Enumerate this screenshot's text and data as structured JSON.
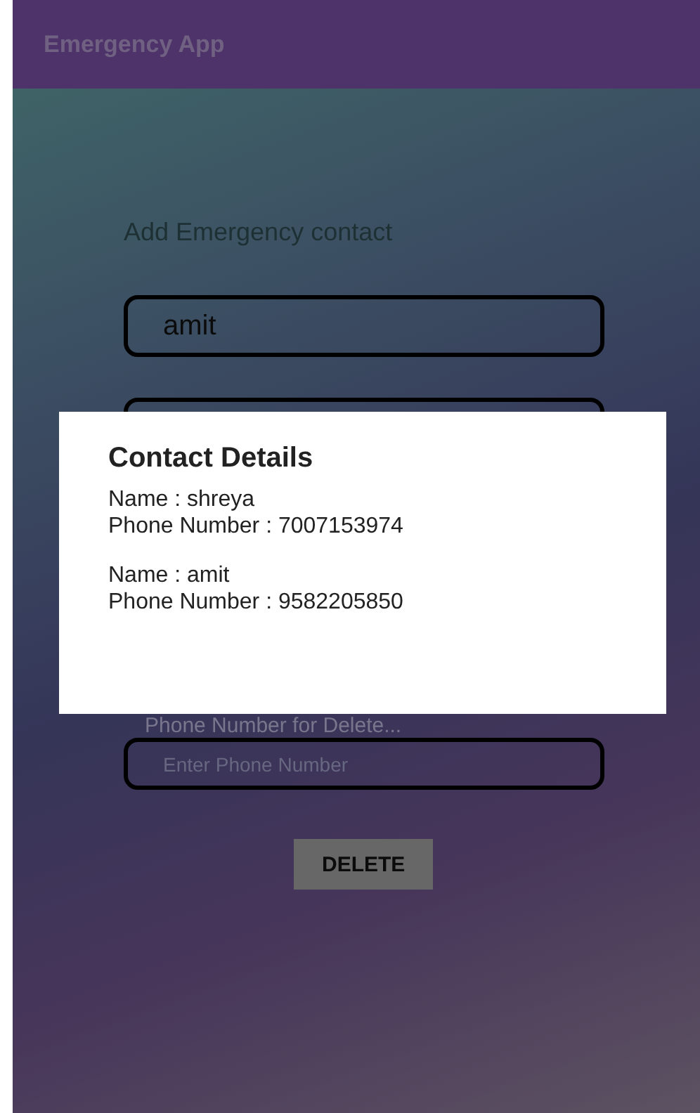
{
  "app_bar": {
    "title": "Emergency App"
  },
  "form": {
    "heading": "Add Emergency contact",
    "name_field": {
      "value": "amit"
    },
    "delete_label": "Phone Number for Delete...",
    "phone_field": {
      "placeholder": "Enter Phone Number"
    },
    "delete_button": "DELETE"
  },
  "dialog": {
    "title": "Contact Details",
    "contacts": [
      {
        "name": "Name : shreya",
        "phone": "Phone Number : 7007153974"
      },
      {
        "name": "Name : amit",
        "phone": "Phone Number : 9582205850"
      }
    ]
  }
}
